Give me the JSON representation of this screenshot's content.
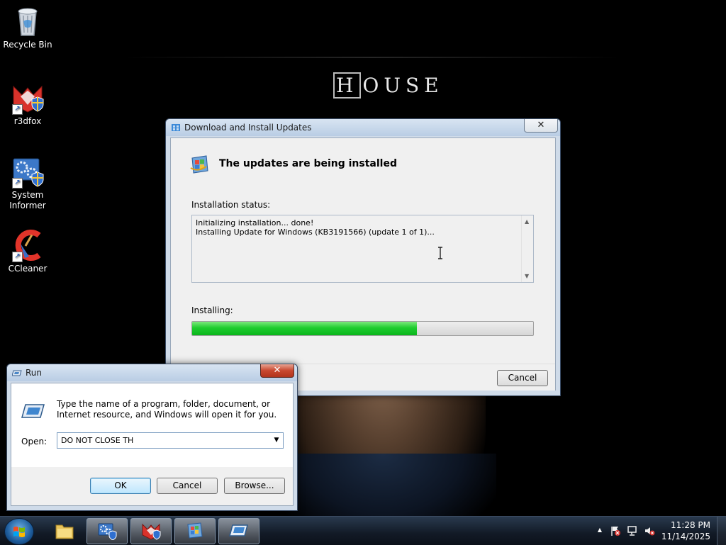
{
  "desktop": {
    "wallpaper_logo": "HOUSE",
    "icons": [
      {
        "label": "Recycle Bin",
        "icon": "recycle-bin-icon"
      },
      {
        "label": "r3dfox",
        "icon": "r3dfox-icon"
      },
      {
        "label": "System Informer",
        "icon": "system-informer-icon"
      },
      {
        "label": "CCleaner",
        "icon": "ccleaner-icon"
      }
    ]
  },
  "update_dialog": {
    "title": "Download and Install Updates",
    "close_label": "✕",
    "heading": "The updates are being installed",
    "status_label": "Installation status:",
    "status_lines": [
      "Initializing installation... done!",
      "Installing Update for Windows (KB3191566) (update 1 of 1)..."
    ],
    "progress_label": "Installing:",
    "progress_fraction": 0.66,
    "cancel_label": "Cancel"
  },
  "run_dialog": {
    "title": "Run",
    "close_label": "✕",
    "description": "Type the name of a program, folder, document, or Internet resource, and Windows will open it for you.",
    "open_label": "Open:",
    "open_value": "DO NOT CLOSE TH",
    "ok_label": "OK",
    "cancel_label": "Cancel",
    "browse_label": "Browse..."
  },
  "taskbar": {
    "start_icon": "windows-start-icon",
    "buttons": [
      {
        "icon": "explorer-folder-icon",
        "active": false
      },
      {
        "icon": "system-informer-icon",
        "active": true
      },
      {
        "icon": "r3dfox-icon",
        "active": true
      },
      {
        "icon": "windows-update-icon",
        "active": true
      },
      {
        "icon": "run-dialog-icon",
        "active": true
      }
    ],
    "tray": {
      "overflow_glyph": "▲",
      "clock_time": "11:28 PM",
      "clock_date": "11/14/2025"
    }
  },
  "colors": {
    "progress_green": "#1fcc2f",
    "close_red": "#c8472e",
    "glass_frame": "#cfdbe9"
  }
}
